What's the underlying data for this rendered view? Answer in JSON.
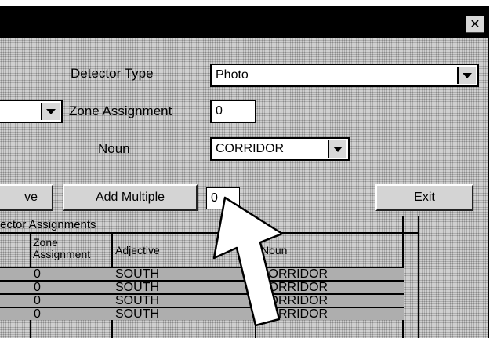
{
  "window": {
    "close_label": "✕"
  },
  "form": {
    "detector_type_label": "Detector Type",
    "detector_type_value": "Photo",
    "zone_assignment_label": "Zone Assignment",
    "zone_assignment_value": "0",
    "noun_label": "Noun",
    "noun_value": "CORRIDOR"
  },
  "actions": {
    "left_button_partial": "ve",
    "add_multiple_label": "Add Multiple",
    "multiple_count_value": "0",
    "exit_label": "Exit"
  },
  "grid": {
    "title": "ector Assignments",
    "headers": {
      "zone_line1": "Zone",
      "zone_line2": "Assignment",
      "adjective": "Adjective",
      "noun": "Noun"
    },
    "rows": [
      {
        "zone": "0",
        "adjective": "SOUTH",
        "noun": "CORRIDOR"
      },
      {
        "zone": "0",
        "adjective": "SOUTH",
        "noun": "CORRIDOR"
      },
      {
        "zone": "0",
        "adjective": "SOUTH",
        "noun": "CORRIDOR"
      },
      {
        "zone": "0",
        "adjective": "SOUTH",
        "noun": "CORRIDOR"
      }
    ]
  }
}
